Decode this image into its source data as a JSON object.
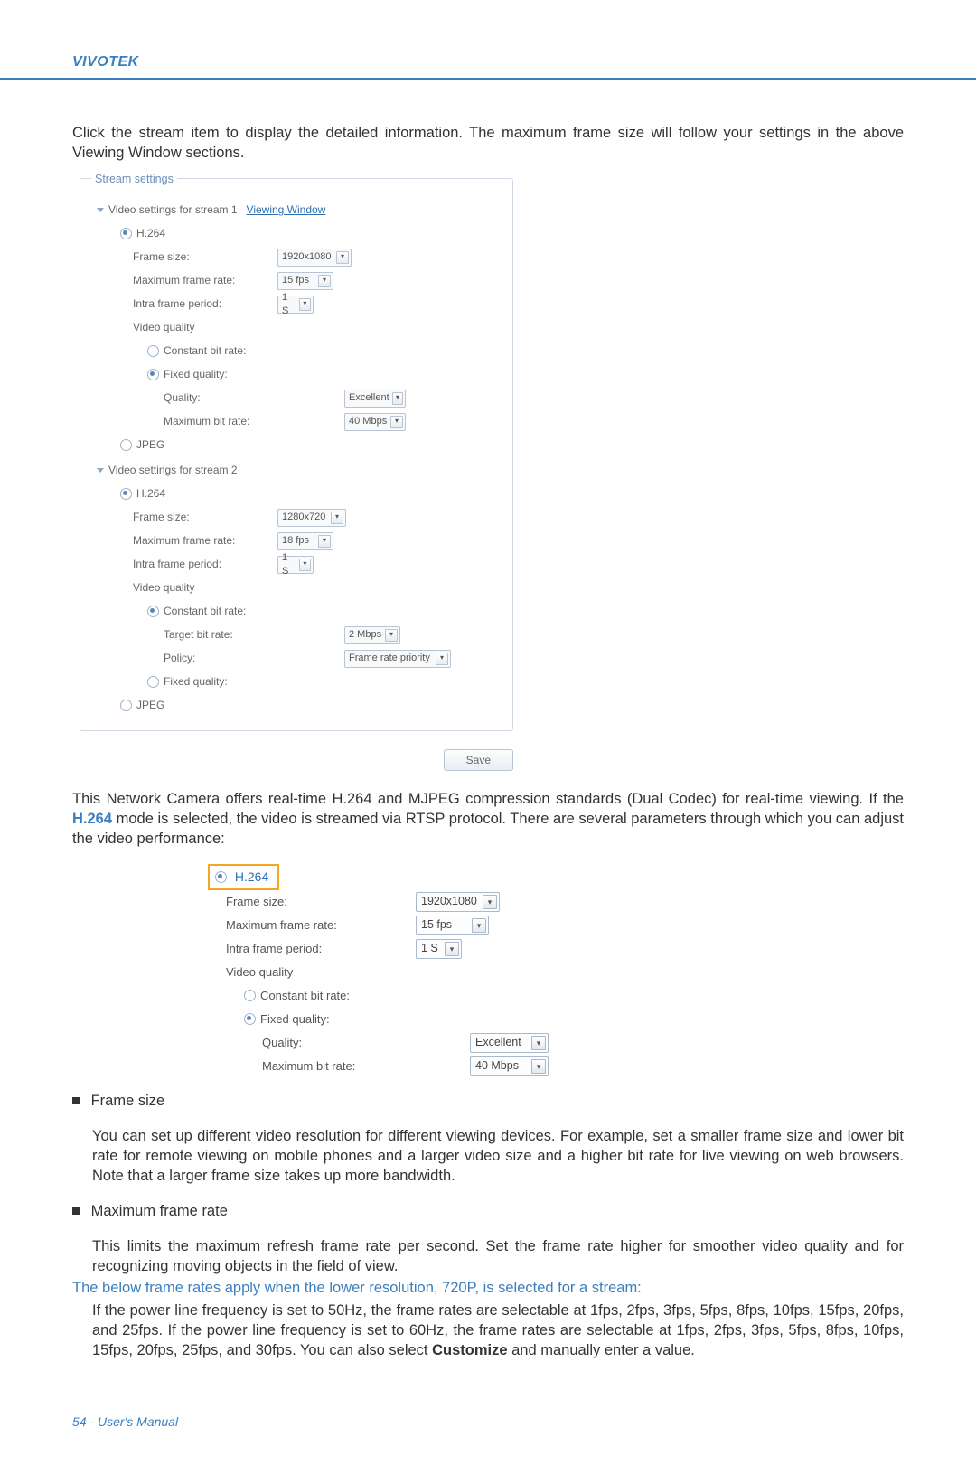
{
  "header": {
    "brand": "VIVOTEK"
  },
  "intro": "Click the stream item to display the detailed information. The maximum frame size will follow your settings in the above Viewing Window sections.",
  "panel": {
    "title": "Stream settings",
    "stream1_header": "Video settings for stream 1",
    "viewing_window": "Viewing Window",
    "codec_h264": "H.264",
    "codec_jpeg": "JPEG",
    "s1": {
      "frame_size_label": "Frame size:",
      "frame_size_val": "1920x1080",
      "max_frame_rate_label": "Maximum frame rate:",
      "max_frame_rate_val": "15 fps",
      "intra_label": "Intra frame period:",
      "intra_val": "1 S",
      "video_quality_label": "Video quality",
      "cbr_label": "Constant bit rate:",
      "fq_label": "Fixed quality:",
      "quality_label": "Quality:",
      "quality_val": "Excellent",
      "max_br_label": "Maximum bit rate:",
      "max_br_val": "40 Mbps"
    },
    "stream2_header": "Video settings for stream 2",
    "s2": {
      "frame_size_label": "Frame size:",
      "frame_size_val": "1280x720",
      "max_frame_rate_label": "Maximum frame rate:",
      "max_frame_rate_val": "18 fps",
      "intra_label": "Intra frame period:",
      "intra_val": "1 S",
      "video_quality_label": "Video quality",
      "cbr_label": "Constant bit rate:",
      "target_br_label": "Target bit rate:",
      "target_br_val": "2 Mbps",
      "policy_label": "Policy:",
      "policy_val": "Frame rate priority",
      "fq_label": "Fixed quality:"
    },
    "save": "Save"
  },
  "para2_a": "This Network Camera offers real-time H.264 and MJPEG compression standards (Dual Codec) for real-time viewing.  If the ",
  "para2_h264": "H.264",
  "para2_b": " mode is selected, the video is streamed via RTSP protocol. There are several parameters through which you can adjust the video performance:",
  "iso": {
    "h264": "H.264",
    "frame_size_label": "Frame size:",
    "frame_size_val": "1920x1080",
    "max_frame_rate_label": "Maximum frame rate:",
    "max_frame_rate_val": "15 fps",
    "intra_label": "Intra frame period:",
    "intra_val": "1 S",
    "video_quality_label": "Video quality",
    "cbr_label": "Constant bit rate:",
    "fq_label": "Fixed quality:",
    "quality_label": "Quality:",
    "quality_val": "Excellent",
    "max_br_label": "Maximum bit rate:",
    "max_br_val": "40 Mbps"
  },
  "bullets": {
    "frame_size_title": "Frame size",
    "frame_size_text": "You can set up different video resolution for different viewing devices. For example, set a smaller frame size and lower bit rate for remote viewing on mobile phones and a larger video size and a higher bit rate for live viewing on web browsers. Note that a larger frame size takes up more bandwidth.",
    "max_fr_title": "Maximum frame rate",
    "max_fr_text1": "This limits the maximum refresh frame rate per second. Set the frame rate higher for smoother video quality and for recognizing moving objects in the field of view.",
    "max_fr_note": "The below frame rates apply when the lower resolution, 720P, is selected for a stream:",
    "max_fr_text2a": "If the power line frequency is set to 50Hz, the frame rates are selectable at 1fps, 2fps, 3fps, 5fps, 8fps, 10fps, 15fps, 20fps, and 25fps. If the power line frequency is set to 60Hz, the frame rates are selectable at 1fps, 2fps, 3fps, 5fps, 8fps, 10fps, 15fps, 20fps, 25fps, and 30fps. You can also select ",
    "customize": "Customize",
    "max_fr_text2b": " and manually enter a value."
  },
  "footer": {
    "page": "54",
    "label": "User's Manual"
  }
}
